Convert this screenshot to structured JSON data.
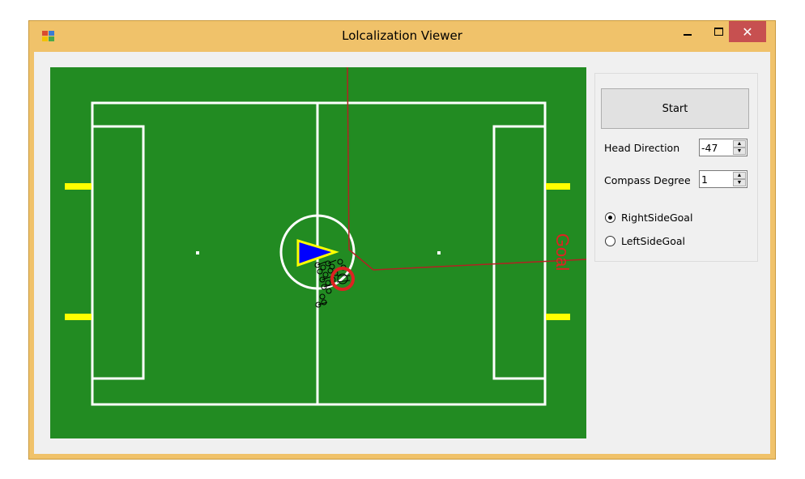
{
  "window": {
    "title": "Lolcalization Viewer",
    "close_glyph": "✕"
  },
  "field": {
    "goal_label": "Goal",
    "colors": {
      "grass": "#228b22",
      "lines": "#ffffff",
      "goal_posts": "#ffff00",
      "robot_marker": "#dd2222",
      "heading_fill": "#0000ff",
      "heading_outline": "#ffff00",
      "path_line": "#b22222"
    }
  },
  "panel": {
    "start_label": "Start",
    "head_direction": {
      "label": "Head Direction",
      "value": "-47"
    },
    "compass_degree": {
      "label": "Compass Degree",
      "value": "1"
    },
    "radios": [
      {
        "label": "RightSideGoal",
        "checked": true
      },
      {
        "label": "LeftSideGoal",
        "checked": false
      }
    ]
  },
  "icons": {
    "app": "app-window-icon",
    "minimize": "minimize-icon",
    "maximize": "maximize-icon",
    "close": "close-icon"
  }
}
